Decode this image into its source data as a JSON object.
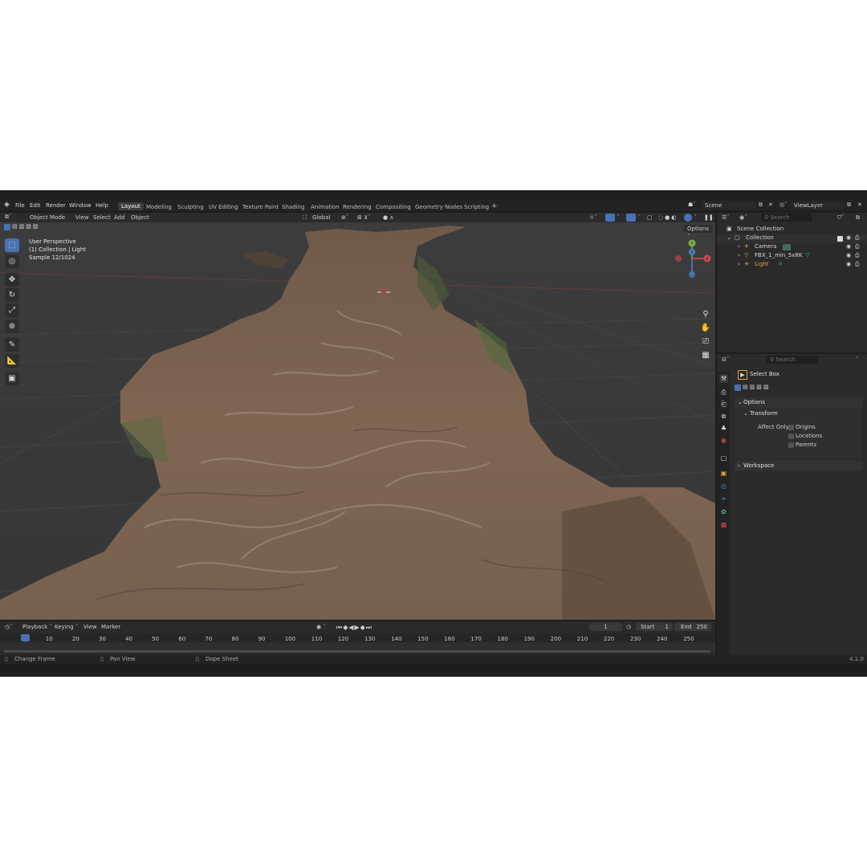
{
  "menu": {
    "file": "File",
    "edit": "Edit",
    "render": "Render",
    "window": "Window",
    "help": "Help"
  },
  "workspaces": [
    "Layout",
    "Modeling",
    "Sculpting",
    "UV Editing",
    "Texture Paint",
    "Shading",
    "Animation",
    "Rendering",
    "Compositing",
    "Geometry Nodes",
    "Scripting"
  ],
  "scene": {
    "name": "Scene",
    "view_layer": "ViewLayer"
  },
  "viewport_header": {
    "mode": "Object Mode",
    "view": "View",
    "select": "Select",
    "add": "Add",
    "object": "Object",
    "transform": "Global",
    "options": "Options"
  },
  "overlay_info": {
    "line1": "User Perspective",
    "line2": "(1) Collection | Light",
    "line3": "Sample 12/1024"
  },
  "gizmo": {
    "x": "X",
    "y": "Y",
    "z": "Z"
  },
  "outliner": {
    "search_placeholder": "Search",
    "scene_collection": "Scene Collection",
    "collection": "Collection",
    "items": [
      "Camera",
      "FBX_1_min_5x8K",
      "Light"
    ]
  },
  "properties": {
    "search_placeholder": "Search",
    "tool_name": "Select Box",
    "options_label": "Options",
    "transform_label": "Transform",
    "affect_only": "Affect Only",
    "checkboxes": [
      "Origins",
      "Locations",
      "Parents"
    ],
    "workspace_label": "Workspace"
  },
  "timeline": {
    "playback": "Playback",
    "keying": "Keying",
    "view": "View",
    "marker": "Marker",
    "current_frame": "1",
    "start_label": "Start",
    "start": "1",
    "end_label": "End",
    "end": "250",
    "ticks": [
      "1",
      "10",
      "20",
      "30",
      "40",
      "50",
      "60",
      "70",
      "80",
      "90",
      "100",
      "110",
      "120",
      "130",
      "140",
      "150",
      "160",
      "170",
      "180",
      "190",
      "200",
      "210",
      "220",
      "230",
      "240",
      "250"
    ]
  },
  "statusbar": {
    "change_frame": "Change Frame",
    "pan_view": "Pan View",
    "dope_sheet": "Dope Sheet",
    "version": "4.1.0"
  },
  "colors": {
    "accent": "#4772b3",
    "active_object": "#e7a13c",
    "axis_x": "#d4494f",
    "axis_y": "#7bb14a",
    "axis_z": "#4f83c7"
  }
}
